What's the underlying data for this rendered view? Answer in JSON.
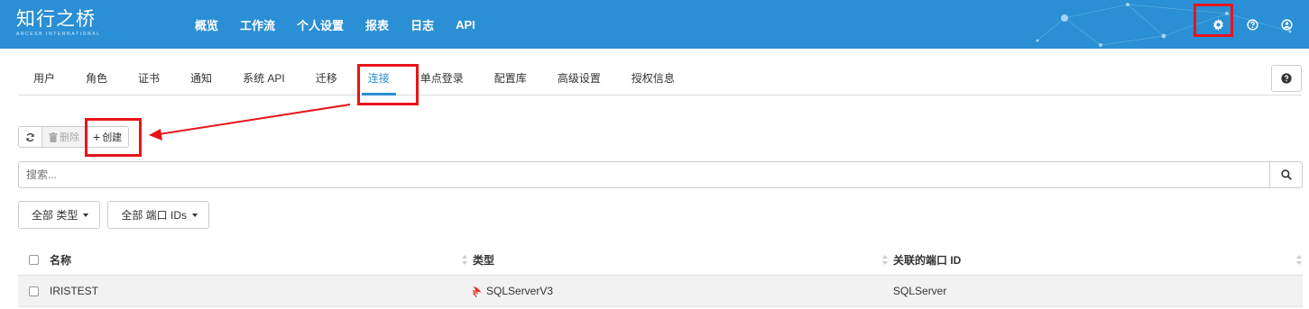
{
  "brand": {
    "name": "知行之桥",
    "subtitle": "ARCESB INTERNATIONAL"
  },
  "mainnav": [
    "概览",
    "工作流",
    "个人设置",
    "报表",
    "日志",
    "API"
  ],
  "topicons": [
    "gear-icon",
    "question-circle-icon",
    "user-circle-icon"
  ],
  "tabs": [
    "用户",
    "角色",
    "证书",
    "通知",
    "系统 API",
    "迁移",
    "连接",
    "单点登录",
    "配置库",
    "高级设置",
    "授权信息"
  ],
  "active_tab": "连接",
  "toolbar": {
    "refresh_icon": "refresh-icon",
    "delete_label": "删除",
    "create_label": "创建"
  },
  "search": {
    "placeholder": "搜索..."
  },
  "filters": {
    "type_label": "全部 类型",
    "port_label": "全部 端口 IDs"
  },
  "table": {
    "headers": [
      "名称",
      "类型",
      "关联的端口 ID"
    ],
    "rows": [
      {
        "name": "IRISTEST",
        "type": "SQLServerV3",
        "port": "SQLServer"
      }
    ]
  },
  "colors": {
    "topbar": "#2a8fd4",
    "accent": "#2a8fd4",
    "highlight": "#e8141a"
  }
}
